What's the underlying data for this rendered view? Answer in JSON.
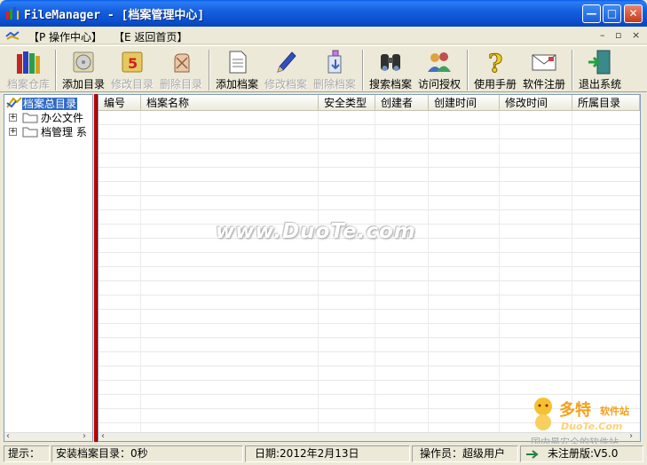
{
  "window": {
    "title": "FileManager - [档案管理中心]",
    "min": "—",
    "max": "□",
    "close": "✕"
  },
  "menu": {
    "items": [
      "【P 操作中心】",
      "【E 返回首页】"
    ],
    "mdi_min": "–",
    "mdi_restore": "▫",
    "mdi_close": "×"
  },
  "toolbar": {
    "buttons": [
      {
        "label": "档案仓库",
        "icon": "books-icon",
        "enabled": false
      },
      {
        "label": "添加目录",
        "icon": "add-folder-disc-icon",
        "enabled": true
      },
      {
        "label": "修改目录",
        "icon": "edit-folder-icon",
        "enabled": false
      },
      {
        "label": "删除目录",
        "icon": "delete-folder-icon",
        "enabled": false
      },
      {
        "label": "添加档案",
        "icon": "add-document-icon",
        "enabled": true
      },
      {
        "label": "修改档案",
        "icon": "pen-icon",
        "enabled": false
      },
      {
        "label": "删除档案",
        "icon": "delete-document-icon",
        "enabled": false
      },
      {
        "label": "搜索档案",
        "icon": "binoculars-icon",
        "enabled": true
      },
      {
        "label": "访问授权",
        "icon": "users-key-icon",
        "enabled": true
      },
      {
        "label": "使用手册",
        "icon": "question-icon",
        "enabled": true
      },
      {
        "label": "软件注册",
        "icon": "envelope-icon",
        "enabled": true
      },
      {
        "label": "退出系统",
        "icon": "exit-door-icon",
        "enabled": true
      }
    ]
  },
  "tree": {
    "root": "档案总目录",
    "children": [
      "办公文件",
      "档管理 系"
    ]
  },
  "list": {
    "columns": [
      "编号",
      "档案名称",
      "安全类型",
      "创建者",
      "创建时间",
      "修改时间",
      "所属目录"
    ]
  },
  "watermark": "www.DuoTe.com",
  "status": {
    "hint_label": "提示：",
    "hint": "安装档案目录：0秒",
    "date": "日期:2012年2月13日",
    "operator": "操作员：超级用户",
    "version": "未注册版:V5.0"
  },
  "brand": {
    "name": "多特",
    "suffix": "软件站",
    "url": "DuoTe.Com",
    "slogan": "国内最安全的软件站"
  },
  "colors": {
    "titlebar": "#0a4fd0",
    "splitter": "#c00000",
    "selection": "#316ac5"
  }
}
